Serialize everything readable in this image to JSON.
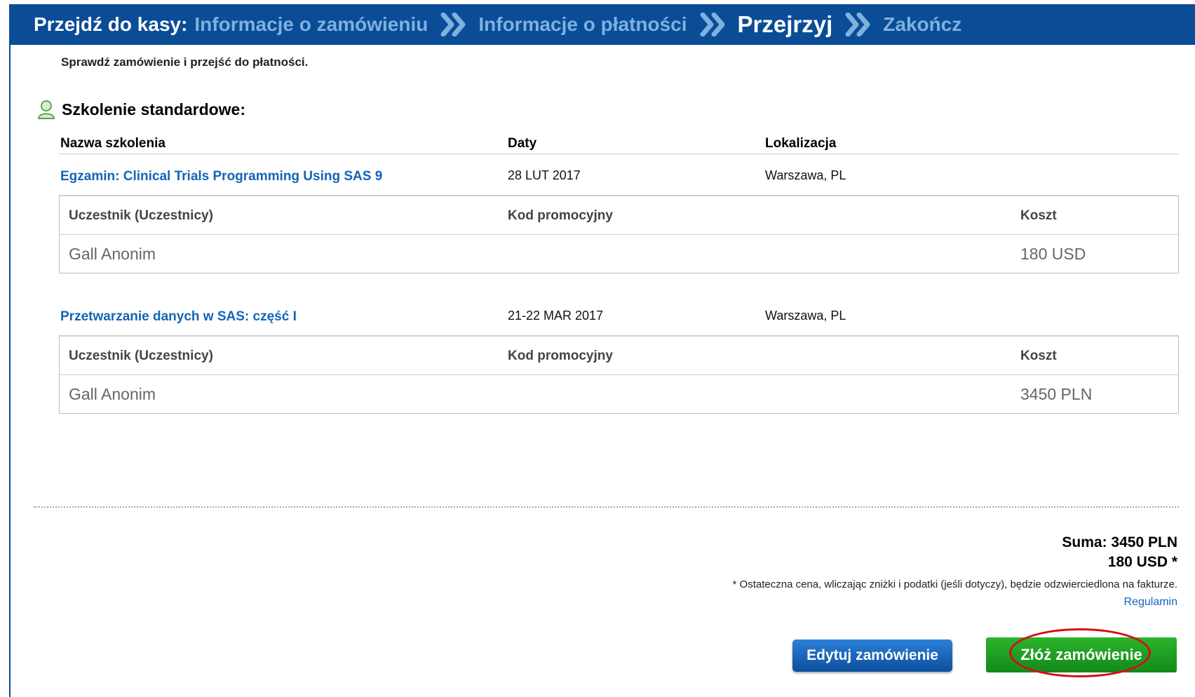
{
  "header": {
    "prefix": "Przejdź do kasy:",
    "steps": [
      {
        "label": "Informacje o zamówieniu"
      },
      {
        "label": "Informacje o płatności"
      },
      {
        "label": "Przejrzyj"
      },
      {
        "label": "Zakończ"
      }
    ],
    "active_step": "Przejrzyj"
  },
  "subtitle": "Sprawdź zamówienie i przejść do płatności.",
  "section": {
    "title": "Szkolenie standardowe:",
    "icon": "person-icon"
  },
  "columns": {
    "name": "Nazwa szkolenia",
    "dates": "Daty",
    "location": "Lokalizacja"
  },
  "courses": [
    {
      "name": "Egzamin: Clinical Trials Programming Using SAS 9",
      "dates": "28 LUT 2017",
      "location": "Warszawa, PL",
      "table": {
        "h_participant": "Uczestnik (Uczestnicy)",
        "h_promo": "Kod promocyjny",
        "h_cost": "Koszt",
        "participant": "Gall Anonim",
        "promo": "",
        "cost": "180 USD"
      }
    },
    {
      "name": "Przetwarzanie danych w SAS: część I",
      "dates": "21-22 MAR 2017",
      "location": "Warszawa, PL",
      "table": {
        "h_participant": "Uczestnik (Uczestnicy)",
        "h_promo": "Kod promocyjny",
        "h_cost": "Koszt",
        "participant": "Gall Anonim",
        "promo": "",
        "cost": "3450 PLN"
      }
    }
  ],
  "summary": {
    "total_line1": "Suma: 3450 PLN",
    "total_line2": "180 USD *",
    "note": "* Ostateczna cena, wliczając zniżki i podatki (jeśli dotyczy), będzie odzwierciedlona na fakturze.",
    "terms_link": "Regulamin"
  },
  "buttons": {
    "edit": "Edytuj zamówienie",
    "place": "Złóż zamówienie"
  },
  "colors": {
    "header_bg": "#0b4c96",
    "inactive_step": "#7fb0e0",
    "link": "#1464b8",
    "edit_button": "#1a66c0",
    "place_button": "#1f9e22",
    "highlight_circle": "#d40e1a"
  }
}
